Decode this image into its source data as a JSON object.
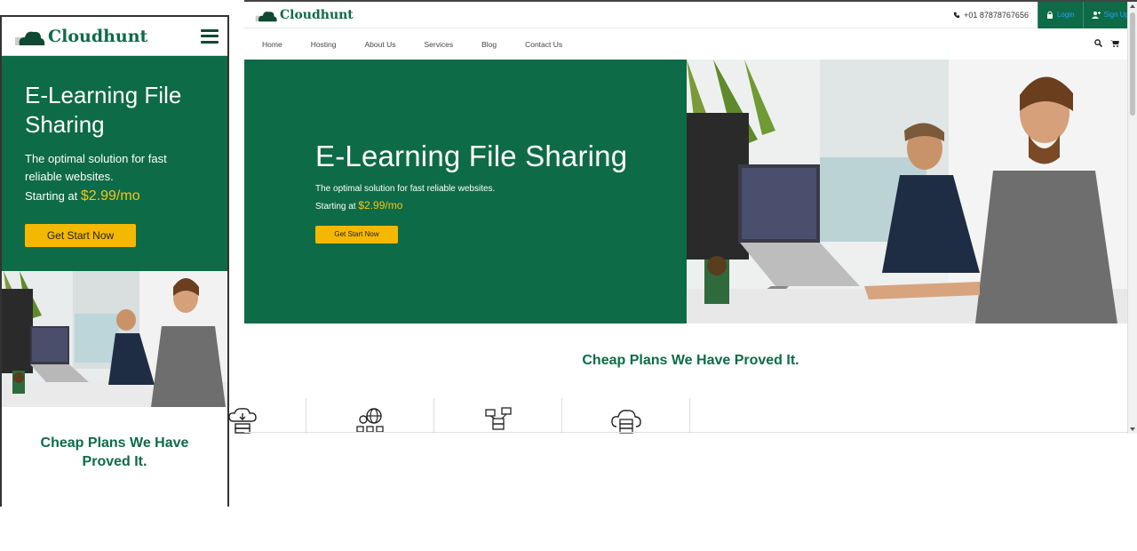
{
  "brand": {
    "name": "Cloudhunt",
    "color": "#0e6b47",
    "accent": "#f5b800"
  },
  "mobile": {
    "hero": {
      "title": "E-Learning File Sharing",
      "subtitle": "The optimal solution for fast reliable websites.",
      "starting_at": "Starting at",
      "price": "$2.99/mo",
      "cta": "Get Start Now"
    },
    "section_title": "Cheap Plans We Have Proved It."
  },
  "desktop": {
    "topbar": {
      "phone": "+01 87878767656",
      "login": "Login",
      "signup": "Sign Up"
    },
    "nav": [
      "Home",
      "Hosting",
      "About Us",
      "Services",
      "Blog",
      "Contact Us"
    ],
    "hero": {
      "title": "E-Learning File Sharing",
      "subtitle": "The optimal solution for fast reliable websites.",
      "starting_at": "Starting at",
      "price": "$2.99/mo",
      "cta": "Get Start Now"
    },
    "section_title": "Cheap Plans We Have Proved It.",
    "plan_icons": [
      "cloud-download-server-icon",
      "network-globe-icon",
      "server-network-icon",
      "cloud-server-icon"
    ]
  }
}
